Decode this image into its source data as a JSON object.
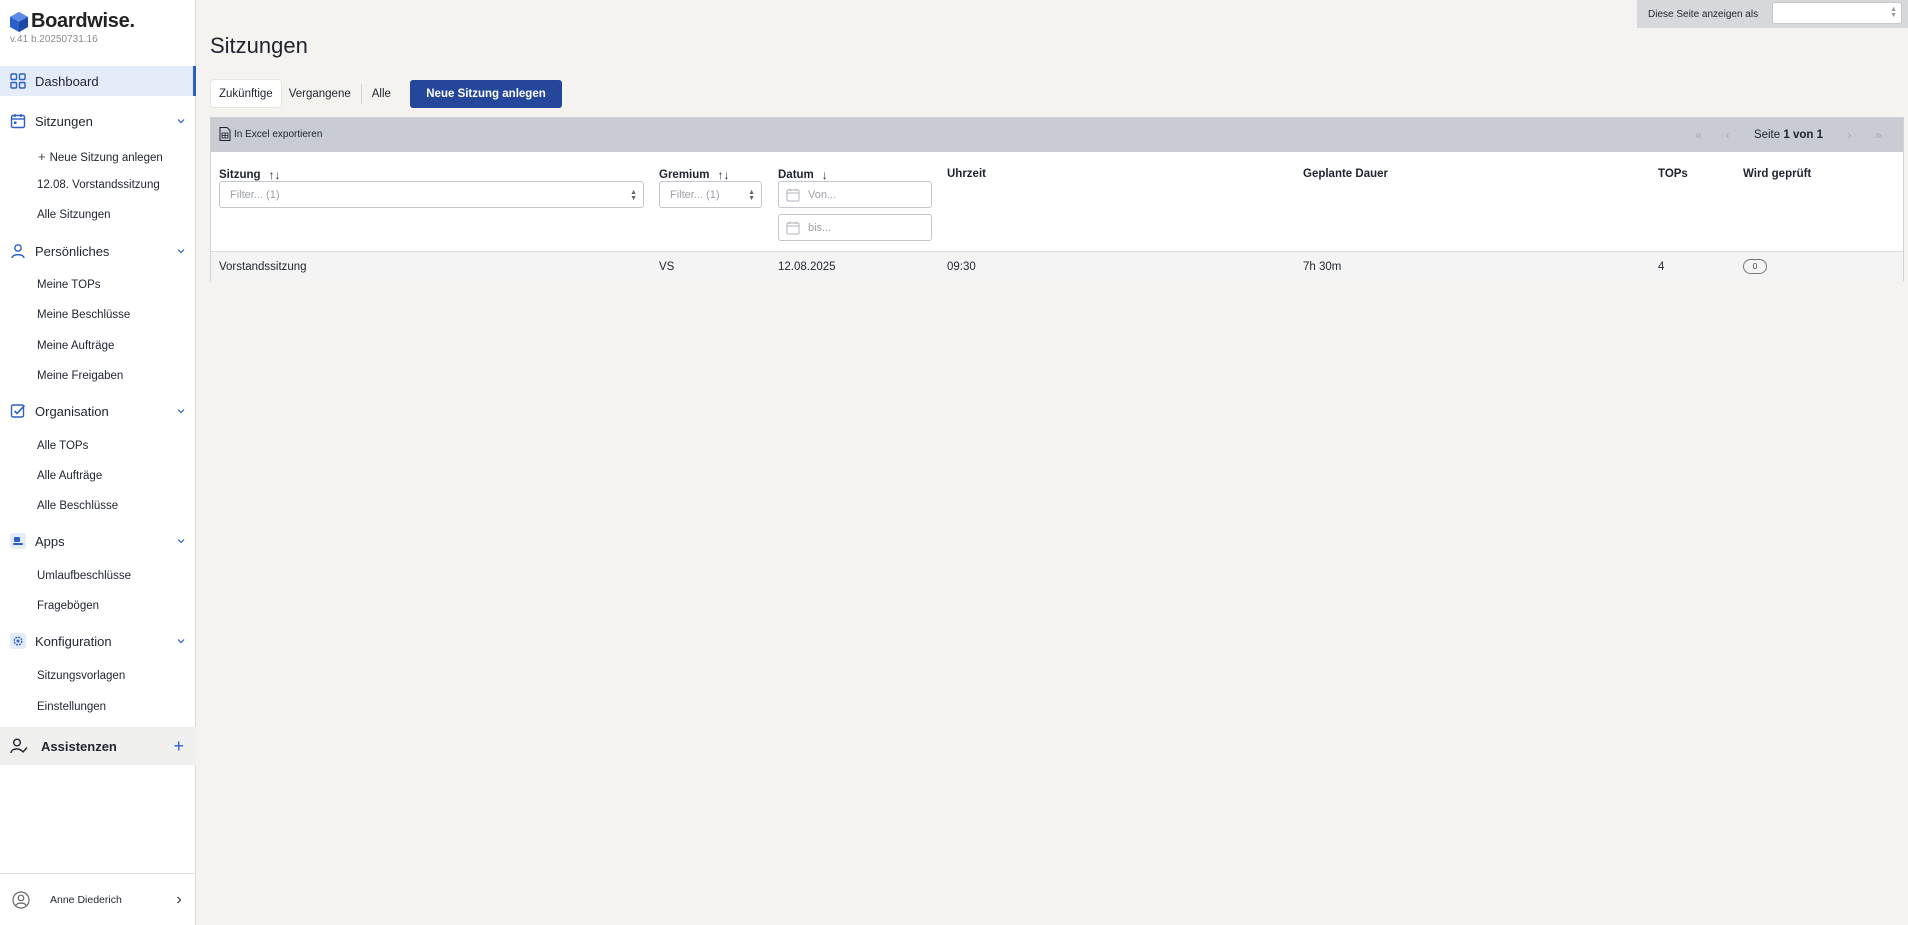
{
  "app": {
    "name": "Boardwise.",
    "version": "v.41 b.20250731.16"
  },
  "sidebar": {
    "dashboard": {
      "label": "Dashboard"
    },
    "sections": [
      {
        "label": "Sitzungen",
        "items": [
          "Neue Sitzung anlegen",
          "12.08. Vorstandssitzung",
          "Alle Sitzungen"
        ]
      },
      {
        "label": "Persönliches",
        "items": [
          "Meine TOPs",
          "Meine Beschlüsse",
          "Meine Aufträge",
          "Meine Freigaben"
        ]
      },
      {
        "label": "Organisation",
        "items": [
          "Alle TOPs",
          "Alle Aufträge",
          "Alle Beschlüsse"
        ]
      },
      {
        "label": "Apps",
        "items": [
          "Umlaufbeschlüsse",
          "Fragebögen"
        ]
      },
      {
        "label": "Konfiguration",
        "items": [
          "Sitzungsvorlagen",
          "Einstellungen"
        ]
      }
    ],
    "assistants": {
      "label": "Assistenzen",
      "add": "+"
    },
    "user": {
      "name": "Anne Diederich"
    }
  },
  "view_as": {
    "label": "Diese Seite anzeigen als",
    "value": ""
  },
  "main": {
    "title": "Sitzungen",
    "tabs": [
      "Zukünftige",
      "Vergangene",
      "Alle"
    ],
    "selected_tab": "Zukünftige",
    "new_button": "Neue Sitzung anlegen"
  },
  "table": {
    "export_label": "In Excel exportieren",
    "pager": {
      "prefix": "Seite",
      "current": "1 von 1"
    },
    "columns": {
      "sitzung": "Sitzung",
      "gremium": "Gremium",
      "datum": "Datum",
      "uhrzeit": "Uhrzeit",
      "dauer": "Geplante Dauer",
      "tops": "TOPs",
      "geprueft": "Wird geprüft"
    },
    "sort_icons": {
      "sitzung": "↑↓",
      "gremium": "↑↓",
      "datum": "↓"
    },
    "filters": {
      "sitzung_placeholder": "Filter... (1)",
      "gremium_placeholder": "Filter... (1)",
      "von_placeholder": "Von...",
      "bis_placeholder": "bis..."
    },
    "rows": [
      {
        "sitzung": "Vorstandssitzung",
        "gremium": "VS",
        "datum": "12.08.2025",
        "uhrzeit": "09:30",
        "dauer": "7h 30m",
        "tops": "4",
        "geprueft": "0"
      }
    ]
  },
  "colors": {
    "primary": "#24479b",
    "accent": "#2b5fc9",
    "active_bg": "#e4ecfa",
    "page_bg": "#f4f3ef"
  }
}
